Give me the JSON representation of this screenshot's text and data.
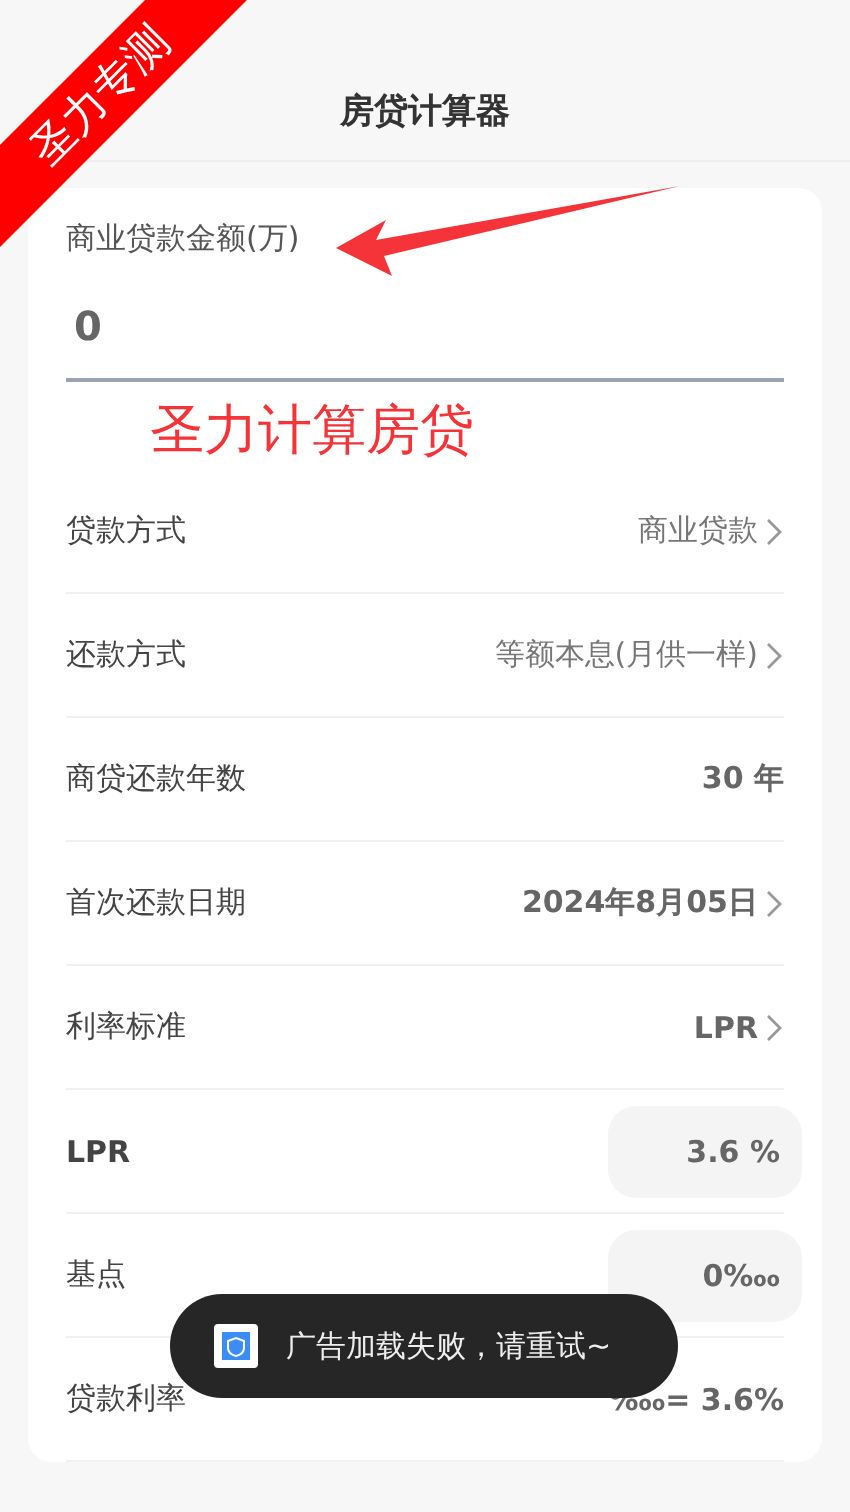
{
  "corner_ribbon": {
    "text": "圣力专测"
  },
  "header": {
    "title": "房贷计算器"
  },
  "amount": {
    "label": "商业贷款金额(万)",
    "value": "0"
  },
  "annotation": {
    "text": "圣力计算房贷"
  },
  "rows": [
    {
      "kind": "select",
      "label": "贷款方式",
      "label_bold": false,
      "value": "商业贷款",
      "value_bold": false
    },
    {
      "kind": "select",
      "label": "还款方式",
      "label_bold": false,
      "value": "等额本息(月供一样)",
      "value_bold": false
    },
    {
      "kind": "text",
      "label": "商贷还款年数",
      "label_bold": false,
      "value": "30 年",
      "value_bold": true
    },
    {
      "kind": "select",
      "label": "首次还款日期",
      "label_bold": false,
      "value": "2024年8月05日",
      "value_bold": true
    },
    {
      "kind": "select",
      "label": "利率标准",
      "label_bold": false,
      "value": "LPR",
      "value_bold": true
    },
    {
      "kind": "input",
      "label": "LPR",
      "label_bold": true,
      "value": "3.6 %",
      "value_bold": true
    },
    {
      "kind": "input",
      "label": "基点",
      "label_bold": false,
      "value": "0‱",
      "value_bold": true
    },
    {
      "kind": "text",
      "label": "贷款利率",
      "label_bold": false,
      "value": "‱= 3.6%",
      "value_bold": true
    }
  ],
  "toast": {
    "text": "广告加载失败，请重试~"
  }
}
